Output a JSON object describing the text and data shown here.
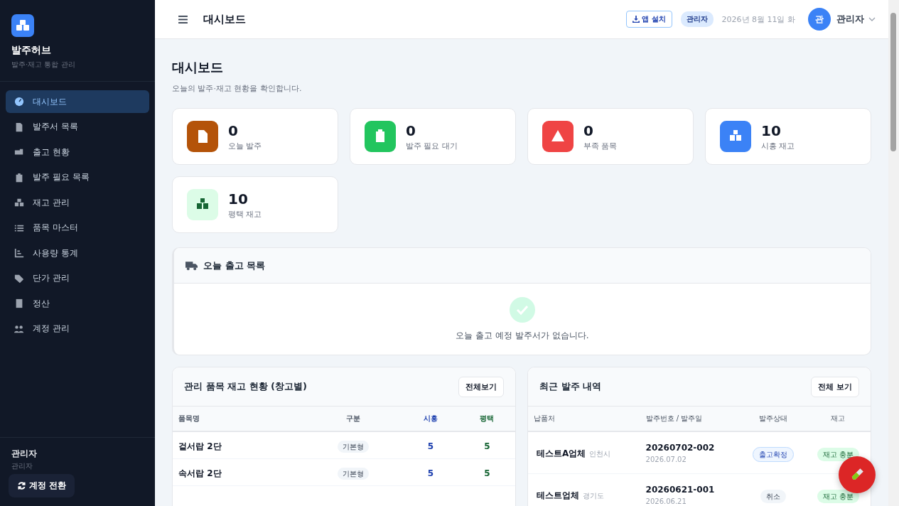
{
  "brand": {
    "name": "발주허브",
    "tagline": "발주·재고 통합 관리"
  },
  "nav": [
    {
      "label": "대시보드",
      "selected": true
    },
    {
      "label": "발주서 목록",
      "selected": false
    },
    {
      "label": "출고 현황",
      "selected": false
    },
    {
      "label": "발주 필요 목록",
      "selected": false
    },
    {
      "label": "재고 관리",
      "selected": false
    },
    {
      "label": "품목 마스터",
      "selected": false
    },
    {
      "label": "사용량 통계",
      "selected": false
    },
    {
      "label": "단가 관리",
      "selected": false
    },
    {
      "label": "정산",
      "selected": false
    },
    {
      "label": "계정 관리",
      "selected": false
    }
  ],
  "user_box": {
    "name": "관리자",
    "role": "관리자",
    "switch_button": "계정 전환"
  },
  "header": {
    "title": "대시보드",
    "install_button": "앱 설치",
    "role_badge": "관리자",
    "date": "2026년 8월 11일 화",
    "avatar": "관",
    "user_name": "관리자"
  },
  "page": {
    "title": "대시보드",
    "subtitle": "오늘의 발주·재고 현황을 확인합니다."
  },
  "stats": [
    {
      "value": "0",
      "label": "오늘 발주",
      "color": "#b45309"
    },
    {
      "value": "0",
      "label": "발주 필요 대기",
      "color": "#22c55e"
    },
    {
      "value": "0",
      "label": "부족 품목",
      "color": "#ef4444"
    },
    {
      "value": "10",
      "label": "시흥 재고",
      "color": "#3b82f6"
    },
    {
      "value": "10",
      "label": "평택 재고",
      "color": "#dcfce7"
    }
  ],
  "shipments": {
    "title": "오늘 출고 목록",
    "empty_message": "오늘 출고 예정 발주서가 없습니다."
  },
  "stock_panel": {
    "title": "관리 품목 재고 현황 (창고별)",
    "view_all": "전체보기",
    "columns": [
      {
        "label": "품목명",
        "kind": "name"
      },
      {
        "label": "구분",
        "kind": "tag"
      },
      {
        "label": "시흥",
        "kind": "qty",
        "color": "#1e40af"
      },
      {
        "label": "평택",
        "kind": "qty",
        "color": "#166534"
      }
    ],
    "rows": [
      {
        "cells": [
          "겉서랍 2단",
          "기본형",
          "5",
          "5"
        ]
      },
      {
        "cells": [
          "속서랍 2단",
          "기본형",
          "5",
          "5"
        ]
      }
    ]
  },
  "orders_panel": {
    "title": "최근 발주 내역",
    "view_all": "전체 보기",
    "columns": [
      "납품처",
      "발주번호 / 발주일",
      "발주상태",
      "재고"
    ],
    "rows": [
      {
        "vendor": "테스트A업체",
        "region": "인천시",
        "order_no": "20260702-002",
        "date": "2026.07.02",
        "status": "출고확정",
        "kind": "confirmed",
        "stock": "재고 충분"
      },
      {
        "vendor": "테스트업체",
        "region": "경기도",
        "order_no": "20260621-001",
        "date": "2026.06.21",
        "status": "취소",
        "kind": "cancelled",
        "stock": "재고 충분"
      }
    ]
  }
}
